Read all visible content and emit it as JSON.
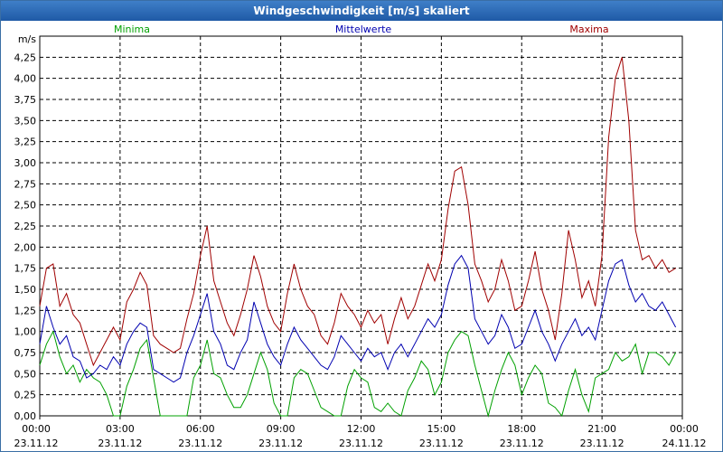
{
  "window": {
    "title": "Windgeschwindigkeit [m/s] skaliert"
  },
  "chart_data": {
    "type": "line",
    "title": "Windgeschwindigkeit [m/s] skaliert",
    "ylabel": "m/s",
    "ylim": [
      0,
      4.5
    ],
    "yticks": [
      "0,00",
      "0,25",
      "0,50",
      "0,75",
      "1,00",
      "1,25",
      "1,50",
      "1,75",
      "2,00",
      "2,25",
      "2,50",
      "2,75",
      "3,00",
      "3,25",
      "3,50",
      "3,75",
      "4,00",
      "4,25"
    ],
    "xticks": [
      {
        "time": "00:00",
        "date": "23.11.12"
      },
      {
        "time": "03:00",
        "date": "23.11.12"
      },
      {
        "time": "06:00",
        "date": "23.11.12"
      },
      {
        "time": "09:00",
        "date": "23.11.12"
      },
      {
        "time": "12:00",
        "date": "23.11.12"
      },
      {
        "time": "15:00",
        "date": "23.11.12"
      },
      {
        "time": "18:00",
        "date": "23.11.12"
      },
      {
        "time": "21:00",
        "date": "23.11.12"
      },
      {
        "time": "00:00",
        "date": "24.11.12"
      }
    ],
    "grid": true,
    "legend_placement": "top",
    "series": [
      {
        "name": "Minima",
        "color": "#00a000",
        "points": [
          [
            0,
            0.6
          ],
          [
            0.25,
            0.85
          ],
          [
            0.5,
            1.0
          ],
          [
            0.75,
            0.7
          ],
          [
            1,
            0.5
          ],
          [
            1.25,
            0.6
          ],
          [
            1.5,
            0.4
          ],
          [
            1.75,
            0.55
          ],
          [
            2,
            0.45
          ],
          [
            2.25,
            0.4
          ],
          [
            2.5,
            0.25
          ],
          [
            2.75,
            0.0
          ],
          [
            3,
            0.0
          ],
          [
            3.25,
            0.35
          ],
          [
            3.5,
            0.55
          ],
          [
            3.75,
            0.8
          ],
          [
            4,
            0.9
          ],
          [
            4.25,
            0.45
          ],
          [
            4.5,
            0.0
          ],
          [
            4.75,
            0.0
          ],
          [
            5,
            0.0
          ],
          [
            5.25,
            0.0
          ],
          [
            5.5,
            0.0
          ],
          [
            5.75,
            0.45
          ],
          [
            6,
            0.6
          ],
          [
            6.25,
            0.9
          ],
          [
            6.5,
            0.5
          ],
          [
            6.75,
            0.45
          ],
          [
            7,
            0.25
          ],
          [
            7.25,
            0.1
          ],
          [
            7.5,
            0.1
          ],
          [
            7.75,
            0.25
          ],
          [
            8,
            0.5
          ],
          [
            8.25,
            0.75
          ],
          [
            8.5,
            0.55
          ],
          [
            8.75,
            0.15
          ],
          [
            9,
            0.0
          ],
          [
            9.25,
            0.0
          ],
          [
            9.5,
            0.45
          ],
          [
            9.75,
            0.55
          ],
          [
            10,
            0.5
          ],
          [
            10.25,
            0.3
          ],
          [
            10.5,
            0.1
          ],
          [
            10.75,
            0.05
          ],
          [
            11,
            0.0
          ],
          [
            11.25,
            0.0
          ],
          [
            11.5,
            0.35
          ],
          [
            11.75,
            0.55
          ],
          [
            12,
            0.45
          ],
          [
            12.25,
            0.4
          ],
          [
            12.5,
            0.1
          ],
          [
            12.75,
            0.05
          ],
          [
            13,
            0.15
          ],
          [
            13.25,
            0.05
          ],
          [
            13.5,
            0.0
          ],
          [
            13.75,
            0.3
          ],
          [
            14,
            0.45
          ],
          [
            14.25,
            0.65
          ],
          [
            14.5,
            0.55
          ],
          [
            14.75,
            0.25
          ],
          [
            15,
            0.4
          ],
          [
            15.25,
            0.75
          ],
          [
            15.5,
            0.9
          ],
          [
            15.75,
            1.0
          ],
          [
            16,
            0.95
          ],
          [
            16.25,
            0.6
          ],
          [
            16.5,
            0.3
          ],
          [
            16.75,
            0.0
          ],
          [
            17,
            0.3
          ],
          [
            17.25,
            0.55
          ],
          [
            17.5,
            0.75
          ],
          [
            17.75,
            0.6
          ],
          [
            18,
            0.25
          ],
          [
            18.25,
            0.45
          ],
          [
            18.5,
            0.6
          ],
          [
            18.75,
            0.5
          ],
          [
            19,
            0.15
          ],
          [
            19.25,
            0.1
          ],
          [
            19.5,
            0.0
          ],
          [
            19.75,
            0.3
          ],
          [
            20,
            0.55
          ],
          [
            20.25,
            0.25
          ],
          [
            20.5,
            0.05
          ],
          [
            20.75,
            0.45
          ],
          [
            21,
            0.5
          ],
          [
            21.25,
            0.55
          ],
          [
            21.5,
            0.75
          ],
          [
            21.75,
            0.65
          ],
          [
            22,
            0.7
          ],
          [
            22.25,
            0.85
          ],
          [
            22.5,
            0.5
          ],
          [
            22.75,
            0.75
          ],
          [
            23,
            0.75
          ],
          [
            23.25,
            0.7
          ],
          [
            23.5,
            0.6
          ],
          [
            23.75,
            0.75
          ]
        ]
      },
      {
        "name": "Mittelwerte",
        "color": "#0000b0",
        "points": [
          [
            0,
            0.85
          ],
          [
            0.25,
            1.3
          ],
          [
            0.5,
            1.05
          ],
          [
            0.75,
            0.85
          ],
          [
            1,
            0.95
          ],
          [
            1.25,
            0.7
          ],
          [
            1.5,
            0.65
          ],
          [
            1.75,
            0.45
          ],
          [
            2,
            0.5
          ],
          [
            2.25,
            0.6
          ],
          [
            2.5,
            0.55
          ],
          [
            2.75,
            0.7
          ],
          [
            3,
            0.6
          ],
          [
            3.25,
            0.85
          ],
          [
            3.5,
            1.0
          ],
          [
            3.75,
            1.1
          ],
          [
            4,
            1.05
          ],
          [
            4.25,
            0.55
          ],
          [
            4.5,
            0.5
          ],
          [
            4.75,
            0.45
          ],
          [
            5,
            0.4
          ],
          [
            5.25,
            0.45
          ],
          [
            5.5,
            0.75
          ],
          [
            5.75,
            0.95
          ],
          [
            6,
            1.2
          ],
          [
            6.25,
            1.45
          ],
          [
            6.5,
            1.0
          ],
          [
            6.75,
            0.85
          ],
          [
            7,
            0.6
          ],
          [
            7.25,
            0.55
          ],
          [
            7.5,
            0.75
          ],
          [
            7.75,
            0.9
          ],
          [
            8,
            1.35
          ],
          [
            8.25,
            1.1
          ],
          [
            8.5,
            0.85
          ],
          [
            8.75,
            0.7
          ],
          [
            9,
            0.6
          ],
          [
            9.25,
            0.85
          ],
          [
            9.5,
            1.05
          ],
          [
            9.75,
            0.9
          ],
          [
            10,
            0.8
          ],
          [
            10.25,
            0.7
          ],
          [
            10.5,
            0.6
          ],
          [
            10.75,
            0.55
          ],
          [
            11,
            0.7
          ],
          [
            11.25,
            0.95
          ],
          [
            11.5,
            0.85
          ],
          [
            11.75,
            0.75
          ],
          [
            12,
            0.65
          ],
          [
            12.25,
            0.8
          ],
          [
            12.5,
            0.7
          ],
          [
            12.75,
            0.75
          ],
          [
            13,
            0.55
          ],
          [
            13.25,
            0.75
          ],
          [
            13.5,
            0.85
          ],
          [
            13.75,
            0.7
          ],
          [
            14,
            0.85
          ],
          [
            14.25,
            1.0
          ],
          [
            14.5,
            1.15
          ],
          [
            14.75,
            1.05
          ],
          [
            15,
            1.2
          ],
          [
            15.25,
            1.55
          ],
          [
            15.5,
            1.8
          ],
          [
            15.75,
            1.9
          ],
          [
            16,
            1.75
          ],
          [
            16.25,
            1.15
          ],
          [
            16.5,
            1.0
          ],
          [
            16.75,
            0.85
          ],
          [
            17,
            0.95
          ],
          [
            17.25,
            1.2
          ],
          [
            17.5,
            1.05
          ],
          [
            17.75,
            0.8
          ],
          [
            18,
            0.85
          ],
          [
            18.25,
            1.05
          ],
          [
            18.5,
            1.25
          ],
          [
            18.75,
            1.0
          ],
          [
            19,
            0.85
          ],
          [
            19.25,
            0.65
          ],
          [
            19.5,
            0.85
          ],
          [
            19.75,
            1.0
          ],
          [
            20,
            1.15
          ],
          [
            20.25,
            0.95
          ],
          [
            20.5,
            1.05
          ],
          [
            20.75,
            0.9
          ],
          [
            21,
            1.25
          ],
          [
            21.25,
            1.6
          ],
          [
            21.5,
            1.8
          ],
          [
            21.75,
            1.85
          ],
          [
            22,
            1.55
          ],
          [
            22.25,
            1.35
          ],
          [
            22.5,
            1.45
          ],
          [
            22.75,
            1.3
          ],
          [
            23,
            1.25
          ],
          [
            23.25,
            1.35
          ],
          [
            23.5,
            1.2
          ],
          [
            23.75,
            1.05
          ]
        ]
      },
      {
        "name": "Maxima",
        "color": "#a00000",
        "points": [
          [
            0,
            1.3
          ],
          [
            0.25,
            1.75
          ],
          [
            0.5,
            1.8
          ],
          [
            0.75,
            1.3
          ],
          [
            1,
            1.45
          ],
          [
            1.25,
            1.2
          ],
          [
            1.5,
            1.1
          ],
          [
            1.75,
            0.85
          ],
          [
            2,
            0.6
          ],
          [
            2.25,
            0.75
          ],
          [
            2.5,
            0.9
          ],
          [
            2.75,
            1.05
          ],
          [
            3,
            0.9
          ],
          [
            3.25,
            1.35
          ],
          [
            3.5,
            1.5
          ],
          [
            3.75,
            1.7
          ],
          [
            4,
            1.55
          ],
          [
            4.25,
            0.95
          ],
          [
            4.5,
            0.85
          ],
          [
            4.75,
            0.8
          ],
          [
            5,
            0.75
          ],
          [
            5.25,
            0.8
          ],
          [
            5.5,
            1.15
          ],
          [
            5.75,
            1.45
          ],
          [
            6,
            1.9
          ],
          [
            6.25,
            2.25
          ],
          [
            6.5,
            1.6
          ],
          [
            6.75,
            1.35
          ],
          [
            7,
            1.1
          ],
          [
            7.25,
            0.95
          ],
          [
            7.5,
            1.2
          ],
          [
            7.75,
            1.5
          ],
          [
            8,
            1.9
          ],
          [
            8.25,
            1.65
          ],
          [
            8.5,
            1.3
          ],
          [
            8.75,
            1.1
          ],
          [
            9,
            1.0
          ],
          [
            9.25,
            1.45
          ],
          [
            9.5,
            1.8
          ],
          [
            9.75,
            1.5
          ],
          [
            10,
            1.3
          ],
          [
            10.25,
            1.2
          ],
          [
            10.5,
            0.95
          ],
          [
            10.75,
            0.85
          ],
          [
            11,
            1.1
          ],
          [
            11.25,
            1.45
          ],
          [
            11.5,
            1.3
          ],
          [
            11.75,
            1.2
          ],
          [
            12,
            1.05
          ],
          [
            12.25,
            1.25
          ],
          [
            12.5,
            1.1
          ],
          [
            12.75,
            1.2
          ],
          [
            13,
            0.85
          ],
          [
            13.25,
            1.15
          ],
          [
            13.5,
            1.4
          ],
          [
            13.75,
            1.15
          ],
          [
            14,
            1.3
          ],
          [
            14.25,
            1.55
          ],
          [
            14.5,
            1.8
          ],
          [
            14.75,
            1.6
          ],
          [
            15,
            1.85
          ],
          [
            15.25,
            2.45
          ],
          [
            15.5,
            2.9
          ],
          [
            15.75,
            2.95
          ],
          [
            16,
            2.5
          ],
          [
            16.25,
            1.8
          ],
          [
            16.5,
            1.6
          ],
          [
            16.75,
            1.35
          ],
          [
            17,
            1.5
          ],
          [
            17.25,
            1.85
          ],
          [
            17.5,
            1.6
          ],
          [
            17.75,
            1.25
          ],
          [
            18,
            1.3
          ],
          [
            18.25,
            1.6
          ],
          [
            18.5,
            1.95
          ],
          [
            18.75,
            1.5
          ],
          [
            19,
            1.25
          ],
          [
            19.25,
            0.9
          ],
          [
            19.5,
            1.45
          ],
          [
            19.75,
            2.2
          ],
          [
            20,
            1.85
          ],
          [
            20.25,
            1.4
          ],
          [
            20.5,
            1.6
          ],
          [
            20.75,
            1.3
          ],
          [
            21,
            1.9
          ],
          [
            21.25,
            3.3
          ],
          [
            21.5,
            4.0
          ],
          [
            21.75,
            4.25
          ],
          [
            22,
            3.5
          ],
          [
            22.25,
            2.2
          ],
          [
            22.5,
            1.85
          ],
          [
            22.75,
            1.9
          ],
          [
            23,
            1.75
          ],
          [
            23.25,
            1.85
          ],
          [
            23.5,
            1.7
          ],
          [
            23.75,
            1.75
          ]
        ]
      }
    ]
  }
}
